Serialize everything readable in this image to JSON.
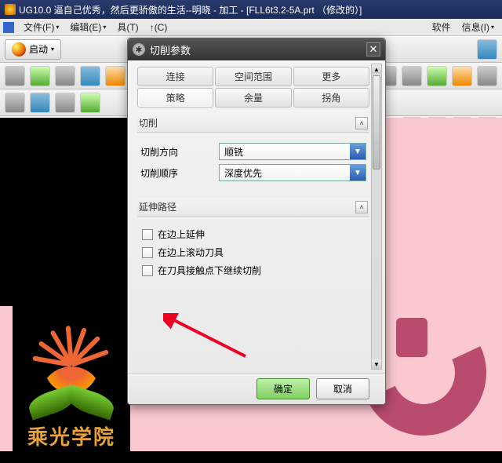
{
  "window": {
    "title": "UG10.0 逼自己优秀，然后更骄傲的生活--明晓 - 加工 - [FLL6t3.2-5A.prt （修改的）]"
  },
  "menubar": {
    "file": "文件(F)",
    "edit": "编辑(E)",
    "tools_trunc": "具(T)",
    "analysis_trunc": "↑(C)",
    "software": "软件",
    "info": "信息(I)"
  },
  "toolbar": {
    "start": "启动"
  },
  "logo_text": "乘光学院",
  "dialog": {
    "title": "切削参数",
    "tabs_row1": {
      "connect": "连接",
      "space": "空间范围",
      "more": "更多"
    },
    "tabs_row2": {
      "strategy": "策略",
      "allowance": "余量",
      "corner": "拐角"
    },
    "section_cut": {
      "title": "切削",
      "dir_label": "切削方向",
      "dir_value": "顺铣",
      "order_label": "切削顺序",
      "order_value": "深度优先"
    },
    "section_ext": {
      "title": "延伸路径",
      "opt1": "在边上延伸",
      "opt2": "在边上滚动刀具",
      "opt3": "在刀具接触点下继续切削"
    },
    "ok": "确定",
    "cancel": "取消"
  }
}
